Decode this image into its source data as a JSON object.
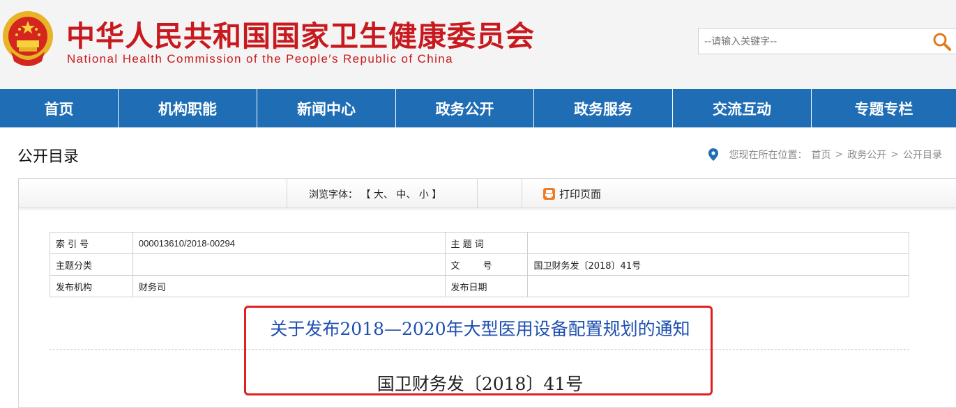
{
  "header": {
    "title_cn": "中华人民共和国国家卫生健康委员会",
    "title_en": "National Health Commission of the People′s Republic of China",
    "search_placeholder": "--请输入关键字--",
    "brand_color": "#c8191e"
  },
  "nav": {
    "items": [
      {
        "label": "首页"
      },
      {
        "label": "机构职能"
      },
      {
        "label": "新闻中心"
      },
      {
        "label": "政务公开"
      },
      {
        "label": "政务服务"
      },
      {
        "label": "交流互动"
      },
      {
        "label": "专题专栏"
      }
    ],
    "color": "#1e6db5"
  },
  "page": {
    "heading": "公开目录",
    "breadcrumb": {
      "prefix": "您现在所在位置：",
      "items": [
        "首页",
        "政务公开",
        "公开目录"
      ],
      "separator": ">"
    }
  },
  "toolbar": {
    "font_label": "浏览字体：",
    "bracket_open": "【",
    "bracket_close": "】",
    "sizes": [
      "大",
      "中",
      "小"
    ],
    "print_label": "打印页面"
  },
  "meta": {
    "rows": [
      [
        {
          "k": "索 引 号",
          "v": "000013610/2018-00294"
        },
        {
          "k": "主 题 词",
          "v": ""
        }
      ],
      [
        {
          "k": "主题分类",
          "v": ""
        },
        {
          "k": "文        号",
          "v": "国卫财务发〔2018〕41号"
        }
      ],
      [
        {
          "k": "发布机构",
          "v": "财务司"
        },
        {
          "k": "发布日期",
          "v": ""
        }
      ]
    ]
  },
  "document": {
    "title": "关于发布2018—2020年大型医用设备配置规划的通知",
    "number": "国卫财务发〔2018〕41号",
    "title_color": "#1f4fb0",
    "highlight_color": "#e02020"
  }
}
